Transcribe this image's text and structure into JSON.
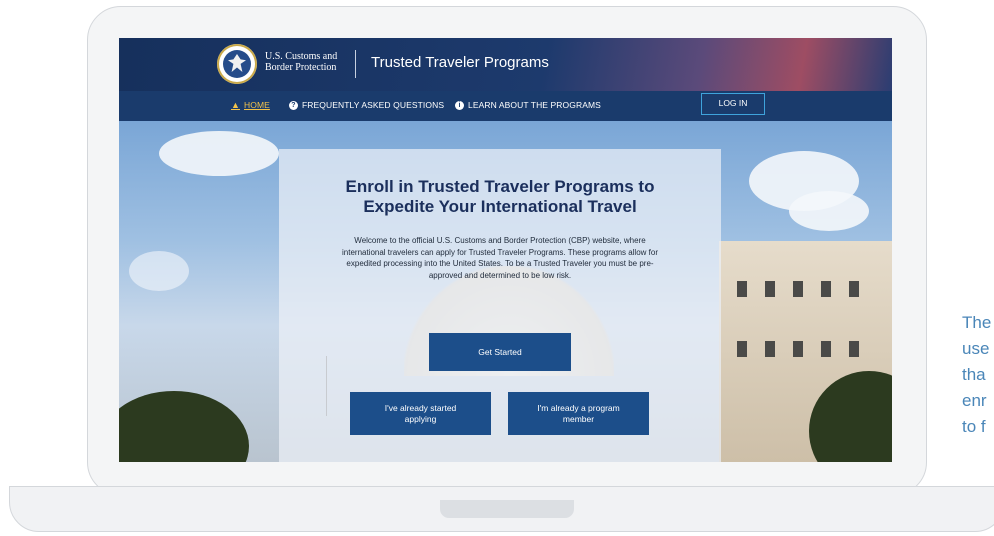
{
  "header": {
    "agency_name_line1": "U.S. Customs and",
    "agency_name_line2": "Border Protection",
    "site_title": "Trusted Traveler Programs"
  },
  "nav": {
    "home": "HOME",
    "faq": "FREQUENTLY ASKED QUESTIONS",
    "learn": "LEARN ABOUT THE PROGRAMS",
    "login": "LOG IN"
  },
  "hero": {
    "title_line1": "Enroll in Trusted Traveler Programs to",
    "title_line2": "Expedite Your International Travel",
    "description": "Welcome to the official U.S. Customs and Border Protection (CBP) website, where international travelers can apply for Trusted Traveler Programs. These programs allow for expedited processing into the United States. To be a Trusted Traveler you must be pre-approved and determined to be low risk.",
    "get_started": "Get Started",
    "already_started_line1": "I've already started",
    "already_started_line2": "applying",
    "program_member_line1": "I'm already a program",
    "program_member_line2": "member"
  },
  "side_text": [
    "The",
    "use",
    "tha",
    "enr",
    "to f"
  ],
  "colors": {
    "header_bg": "#16305c",
    "nav_bg": "#1a3b6c",
    "home_link": "#f3c34a",
    "button_bg": "#1c4e8a",
    "login_border": "#3fa3dc",
    "title_text": "#1b2f5c"
  },
  "icons": {
    "home": "home-icon",
    "faq": "question-circle-icon",
    "learn": "info-circle-icon",
    "logo": "dhs-seal-icon"
  }
}
